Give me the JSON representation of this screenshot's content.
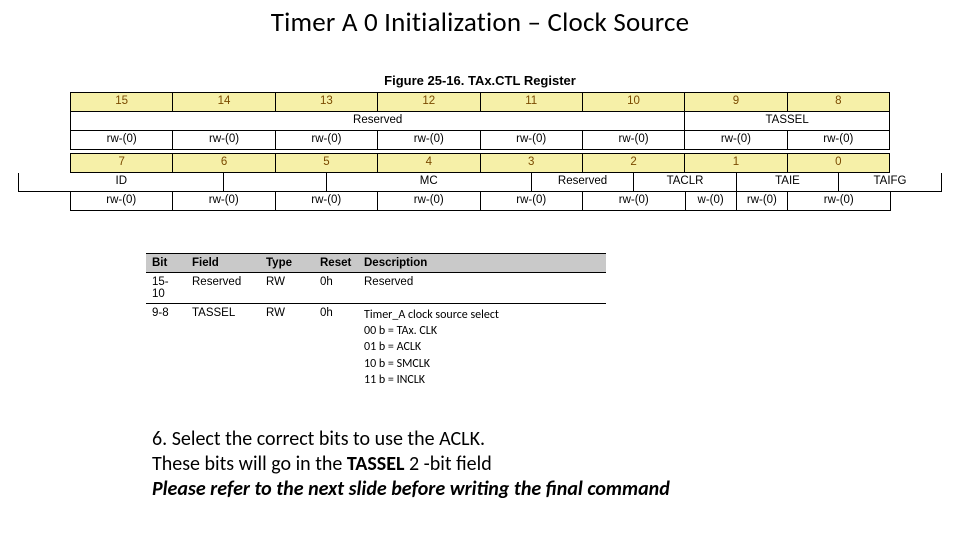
{
  "title": "Timer A 0 Initialization – Clock Source",
  "figure_caption": "Figure 25-16. TAx.CTL Register",
  "bits_hi": [
    "15",
    "14",
    "13",
    "12",
    "11",
    "10",
    "9",
    "8"
  ],
  "names_hi": {
    "reserved": "Reserved",
    "tassel": "TASSEL"
  },
  "rw_hi": [
    "rw-(0)",
    "rw-(0)",
    "rw-(0)",
    "rw-(0)",
    "rw-(0)",
    "rw-(0)",
    "rw-(0)",
    "rw-(0)"
  ],
  "bits_lo": [
    "7",
    "6",
    "5",
    "4",
    "3",
    "2",
    "1",
    "0"
  ],
  "names_lo": {
    "id": "ID",
    "mc": "MC",
    "reserved": "Reserved",
    "taclr": "TACLR",
    "taie": "TAIE",
    "taifg": "TAIFG"
  },
  "rw_lo": [
    "rw-(0)",
    "rw-(0)",
    "rw-(0)",
    "rw-(0)",
    "rw-(0)",
    "rw-(0)",
    "w-(0)",
    "rw-(0)",
    "rw-(0)"
  ],
  "desc": {
    "headers": {
      "bit": "Bit",
      "field": "Field",
      "type": "Type",
      "reset": "Reset",
      "desc": "Description"
    },
    "row1": {
      "bit": "15-10",
      "field": "Reserved",
      "type": "RW",
      "reset": "0h",
      "desc": "Reserved"
    },
    "row2": {
      "bit": "9-8",
      "field": "TASSEL",
      "type": "RW",
      "reset": "0h",
      "desc_head": "Timer_A clock source select",
      "opts": [
        "00 b = TAx. CLK",
        "01 b = ACLK",
        "10 b = SMCLK",
        "11 b = INCLK"
      ]
    }
  },
  "inst": {
    "l1a": "6. Select the correct bits to use the ACLK.",
    "l2a": "These bits will go in the ",
    "l2b": "TASSEL",
    "l2c": " 2 -bit field",
    "l3": "Please refer to the next slide before writing the final command"
  }
}
